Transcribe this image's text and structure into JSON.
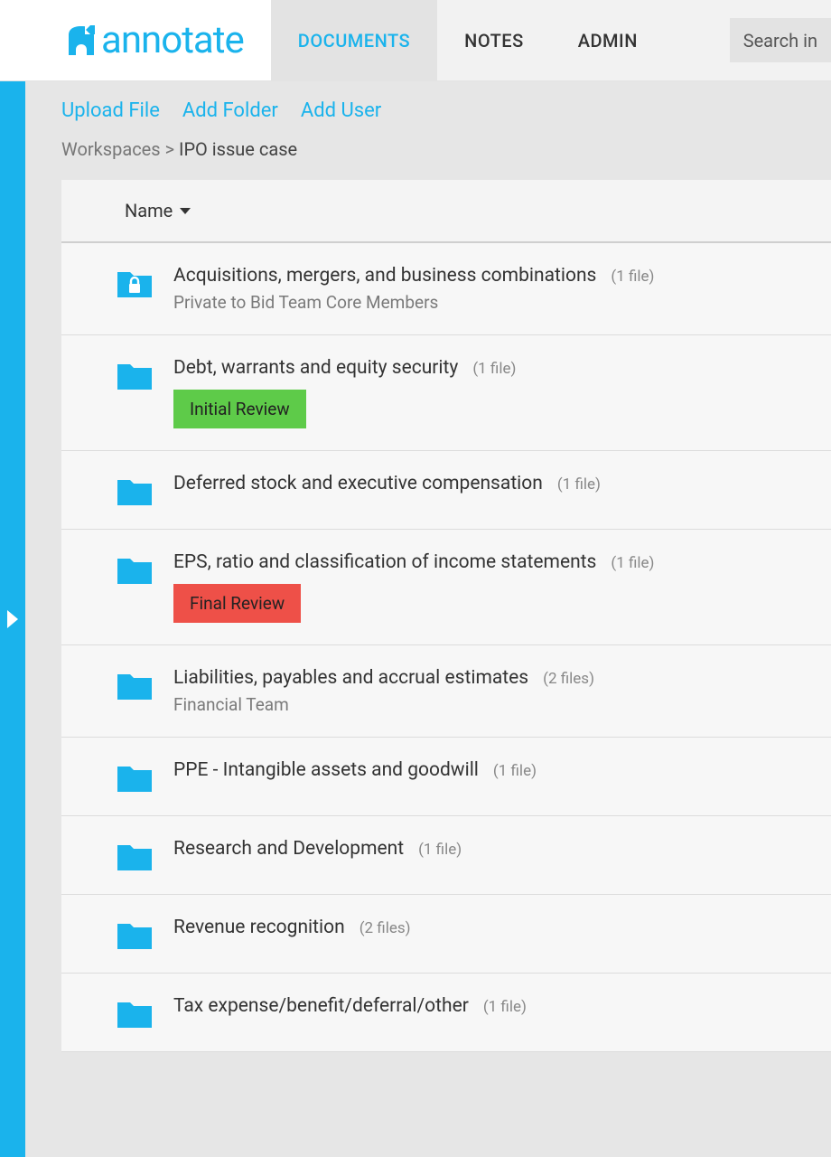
{
  "brand": "annotate",
  "nav": {
    "documents": "DOCUMENTS",
    "notes": "NOTES",
    "admin": "ADMIN"
  },
  "search": {
    "placeholder": "Search in"
  },
  "actions": {
    "upload": "Upload File",
    "add_folder": "Add Folder",
    "add_user": "Add User"
  },
  "breadcrumb": {
    "root": "Workspaces",
    "sep": ">",
    "current": "IPO issue case"
  },
  "columns": {
    "name": "Name"
  },
  "folders": [
    {
      "title": "Acquisitions, mergers, and business combinations",
      "count": "(1 file)",
      "subtitle": "Private to Bid Team Core Members",
      "locked": true
    },
    {
      "title": "Debt, warrants and equity security",
      "count": "(1 file)",
      "tag": {
        "label": "Initial Review",
        "color": "green"
      }
    },
    {
      "title": "Deferred stock and executive compensation",
      "count": "(1 file)"
    },
    {
      "title": "EPS, ratio and classification of income statements",
      "count": "(1 file)",
      "tag": {
        "label": "Final Review",
        "color": "red"
      }
    },
    {
      "title": "Liabilities, payables and accrual estimates",
      "count": "(2 files)",
      "subtitle": "Financial Team"
    },
    {
      "title": "PPE - Intangible assets and goodwill",
      "count": "(1 file)"
    },
    {
      "title": "Research and Development",
      "count": "(1 file)"
    },
    {
      "title": "Revenue recognition",
      "count": "(2 files)"
    },
    {
      "title": "Tax expense/benefit/deferral/other",
      "count": "(1 file)"
    }
  ]
}
